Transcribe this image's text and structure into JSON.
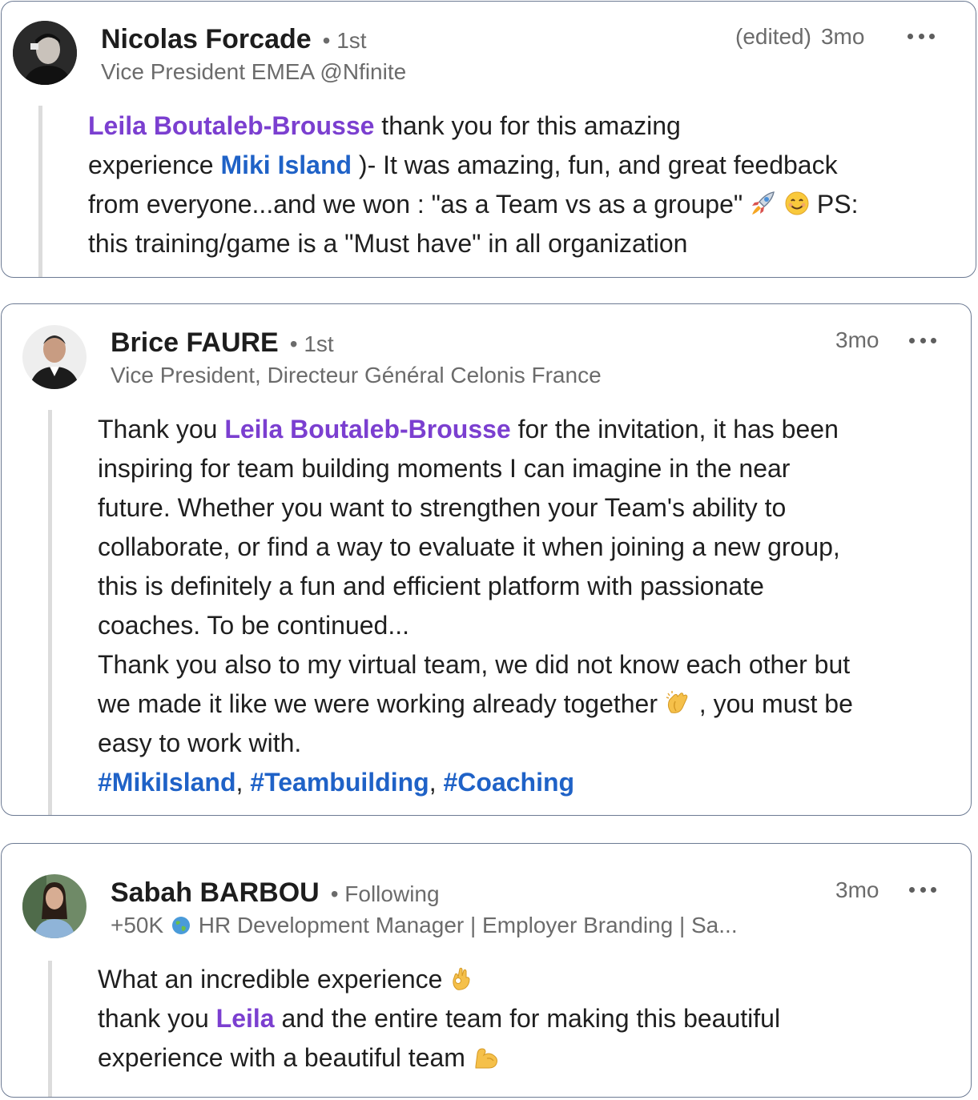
{
  "comments": [
    {
      "author": "Nicolas Forcade",
      "connection": "• 1st",
      "headline": "Vice President EMEA @Nfinite",
      "edited": "(edited)",
      "time": "3mo",
      "body": {
        "mention": "Leila Boutaleb-Brousse",
        "t1": " thank you for this amazing",
        "t2": "experience ",
        "link": "Miki Island",
        "t3": " )- It was amazing, fun, and great feedback",
        "t4": "from everyone...and we won : \"as a Team vs as a groupe\" ",
        "t5": " PS:",
        "t6": "this training/game is a \"Must have\" in all organization"
      }
    },
    {
      "author": "Brice FAURE",
      "connection": "• 1st",
      "headline": "Vice President, Directeur Général Celonis France",
      "time": "3mo",
      "body": {
        "t1": "Thank you ",
        "mention": "Leila Boutaleb-Brousse",
        "t2": " for the invitation, it has been",
        "t3": "inspiring for team building moments I can imagine in the near",
        "t4": "future. Whether you want to strengthen your Team's ability to",
        "t5": "collaborate, or find a way to evaluate it when joining a new group,",
        "t6": "this is definitely a fun and efficient platform with passionate",
        "t7": "coaches. To be continued...",
        "t8": "Thank you also to my virtual team, we did not know each other but",
        "t9": "we made it like we were working already together ",
        "t10": " , you must be",
        "t11": "easy to work with.",
        "tags": [
          "#MikiIsland",
          "#Teambuilding",
          "#Coaching"
        ],
        "sep": ", "
      }
    },
    {
      "author": "Sabah BARBOU",
      "connection": "• Following",
      "headline_pre": "+50K",
      "headline": "HR Development Manager | Employer Branding | Sa...",
      "time": "3mo",
      "body": {
        "t1": "What an incredible experience ",
        "t2": "thank you ",
        "mention": "Leila",
        "t3": " and the entire team for making this beautiful",
        "t4": "experience with a beautiful team "
      }
    }
  ],
  "icons": {
    "more": "more-options-icon",
    "rocket": "rocket-emoji-icon",
    "smile": "smiling-face-emoji-icon",
    "clap": "clapping-hands-emoji-icon",
    "ok": "ok-hand-emoji-icon",
    "muscle": "flexed-biceps-emoji-icon",
    "globe": "globe-icon"
  },
  "colors": {
    "mention": "#7b3fd0",
    "link": "#1f62c7",
    "border": "#6c7a93"
  }
}
